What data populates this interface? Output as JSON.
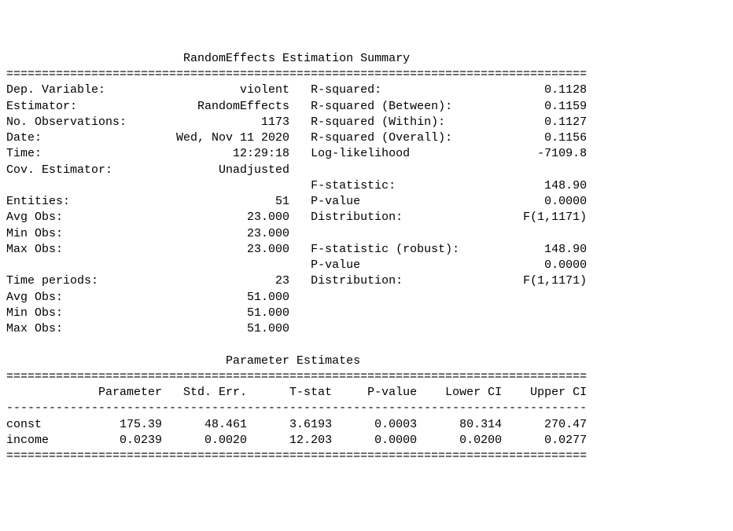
{
  "title": "RandomEffects Estimation Summary",
  "summary_left": [
    {
      "label": "Dep. Variable:",
      "value": "violent"
    },
    {
      "label": "Estimator:",
      "value": "RandomEffects"
    },
    {
      "label": "No. Observations:",
      "value": "1173"
    },
    {
      "label": "Date:",
      "value": "Wed, Nov 11 2020"
    },
    {
      "label": "Time:",
      "value": "12:29:18"
    },
    {
      "label": "Cov. Estimator:",
      "value": "Unadjusted"
    },
    {
      "label": "",
      "value": ""
    },
    {
      "label": "Entities:",
      "value": "51"
    },
    {
      "label": "Avg Obs:",
      "value": "23.000"
    },
    {
      "label": "Min Obs:",
      "value": "23.000"
    },
    {
      "label": "Max Obs:",
      "value": "23.000"
    },
    {
      "label": "",
      "value": ""
    },
    {
      "label": "Time periods:",
      "value": "23"
    },
    {
      "label": "Avg Obs:",
      "value": "51.000"
    },
    {
      "label": "Min Obs:",
      "value": "51.000"
    },
    {
      "label": "Max Obs:",
      "value": "51.000"
    }
  ],
  "summary_right": [
    {
      "label": "R-squared:",
      "value": "0.1128"
    },
    {
      "label": "R-squared (Between):",
      "value": "0.1159"
    },
    {
      "label": "R-squared (Within):",
      "value": "0.1127"
    },
    {
      "label": "R-squared (Overall):",
      "value": "0.1156"
    },
    {
      "label": "Log-likelihood",
      "value": "-7109.8"
    },
    {
      "label": "",
      "value": ""
    },
    {
      "label": "F-statistic:",
      "value": "148.90"
    },
    {
      "label": "P-value",
      "value": "0.0000"
    },
    {
      "label": "Distribution:",
      "value": "F(1,1171)"
    },
    {
      "label": "",
      "value": ""
    },
    {
      "label": "F-statistic (robust):",
      "value": "148.90"
    },
    {
      "label": "P-value",
      "value": "0.0000"
    },
    {
      "label": "Distribution:",
      "value": "F(1,1171)"
    },
    {
      "label": "",
      "value": ""
    },
    {
      "label": "",
      "value": ""
    },
    {
      "label": "",
      "value": ""
    }
  ],
  "param_title": "Parameter Estimates",
  "param_headers": [
    "",
    "Parameter",
    "Std. Err.",
    "T-stat",
    "P-value",
    "Lower CI",
    "Upper CI"
  ],
  "param_rows": [
    {
      "name": "const",
      "parameter": "175.39",
      "stderr": "48.461",
      "tstat": "3.6193",
      "pvalue": "0.0003",
      "lower": "80.314",
      "upper": "270.47"
    },
    {
      "name": "income",
      "parameter": "0.0239",
      "stderr": "0.0020",
      "tstat": "12.203",
      "pvalue": "0.0000",
      "lower": "0.0200",
      "upper": "0.0277"
    }
  ],
  "width": 82,
  "left_label_w": 20,
  "left_value_w": 20,
  "gap": 3,
  "right_label_w": 24,
  "right_value_w": 15,
  "param_col_w": [
    10,
    12,
    12,
    12,
    12,
    12,
    12
  ]
}
